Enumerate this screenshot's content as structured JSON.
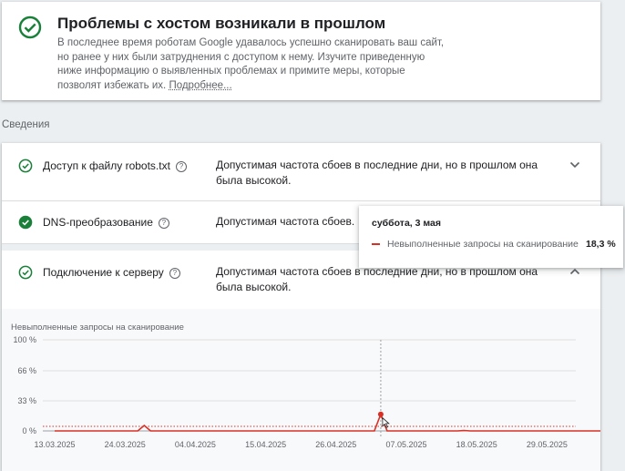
{
  "top": {
    "title": "Проблемы с хостом возникали в прошлом",
    "description": "В последнее время роботам Google удавалось успешно сканировать ваш сайт, но ранее у них были затруднения с доступом к нему. Изучите приведенную ниже информацию о выявленных проблемах и примите меры, которые позволят избежать их. ",
    "more_link": "Подробнее..."
  },
  "section_label": "Сведения",
  "rows": [
    {
      "name": "Доступ к файлу robots.txt",
      "desc": "Допустимая частота сбоев в последние дни, но в прошлом она была высокой.",
      "expanded": false,
      "icon": "check-circle-outline-icon"
    },
    {
      "name": "DNS-преобразование",
      "desc": "Допустимая частота сбоев.",
      "expanded": false,
      "icon": "check-circle-filled-icon"
    },
    {
      "name": "Подключение к серверу",
      "desc": "Допустимая частота сбоев в последние дни, но в прошлом она была высокой.",
      "expanded": true,
      "icon": "check-circle-outline-icon"
    }
  ],
  "help_glyph": "?",
  "colors": {
    "accent_green": "#188038",
    "series_red": "#d93025"
  },
  "chart_data": {
    "type": "line",
    "title": "Невыполненные запросы на сканирование",
    "y_ticks": [
      "100 %",
      "66 %",
      "33 %",
      "0 %"
    ],
    "ylim": [
      0,
      100
    ],
    "x_ticks": [
      "13.03.2025",
      "24.03.2025",
      "04.04.2025",
      "15.04.2025",
      "26.04.2025",
      "07.05.2025",
      "18.05.2025",
      "29.05.2025"
    ],
    "series": [
      {
        "name": "Невыполненные запросы на сканирование",
        "points": [
          [
            "2025-03-13",
            0
          ],
          [
            "2025-03-26",
            0
          ],
          [
            "2025-03-27",
            6
          ],
          [
            "2025-03-28",
            0
          ],
          [
            "2025-05-02",
            0
          ],
          [
            "2025-05-03",
            18.3
          ],
          [
            "2025-05-04",
            0
          ],
          [
            "2025-05-15",
            0
          ],
          [
            "2025-05-16",
            0.5
          ],
          [
            "2025-05-17",
            0
          ],
          [
            "2025-06-07",
            0
          ]
        ]
      }
    ],
    "threshold": 5,
    "hover_date": "2025-05-03"
  },
  "tooltip": {
    "date": "суббота, 3 мая",
    "series": "Невыполненные запросы на сканирование",
    "value": "18,3 %"
  }
}
